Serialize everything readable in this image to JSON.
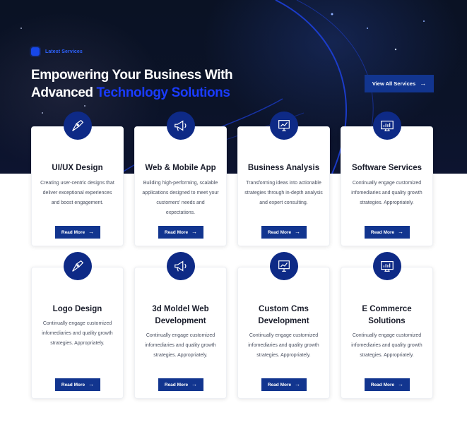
{
  "header": {
    "eyebrow": "Latest Services",
    "headline_line1": "Empowering Your Business With",
    "headline_line2_plain": "Advanced",
    "headline_line2_accent": "Technology Solutions",
    "view_all_label": "View All Services"
  },
  "colors": {
    "accent": "#1a3cff",
    "button": "#12358f",
    "icon_bg": "#0e2a86"
  },
  "cards": [
    {
      "title": "UI/UX Design",
      "desc": "Creating user-centric designs that deliver exceptional experiences and boost engagement.",
      "button": "Read More",
      "icon": "design-pen-icon"
    },
    {
      "title": "Web & Mobile App",
      "desc": "Building high-performing, scalable applications designed to meet your customers' needs and expectations.",
      "button": "Read More",
      "icon": "megaphone-icon"
    },
    {
      "title": "Business Analysis",
      "desc": "Transforming ideas into actionable strategies through in-depth analysis and expert consulting.",
      "button": "Read More",
      "icon": "presentation-chart-icon"
    },
    {
      "title": "Software Services",
      "desc": "Continually engage customized infomediaries and quality growth strategies. Appropriately.",
      "button": "Read More",
      "icon": "monitor-analytics-icon"
    },
    {
      "title": "Logo Design",
      "desc": "Continually engage customized infomediaries and quality growth strategies. Appropriately.",
      "button": "Read More",
      "icon": "design-pen-icon"
    },
    {
      "title": "3d Moldel Web Development",
      "desc": "Continually engage customized infomediaries and quality growth strategies. Appropriately.",
      "button": "Read More",
      "icon": "megaphone-icon"
    },
    {
      "title": "Custom Cms Development",
      "desc": "Continually engage customized infomediaries and quality growth strategies. Appropriately.",
      "button": "Read More",
      "icon": "presentation-chart-icon"
    },
    {
      "title": "E Commerce Solutions",
      "desc": "Continually engage customized infomediaries and quality growth strategies. Appropriately.",
      "button": "Read More",
      "icon": "monitor-analytics-icon"
    }
  ]
}
